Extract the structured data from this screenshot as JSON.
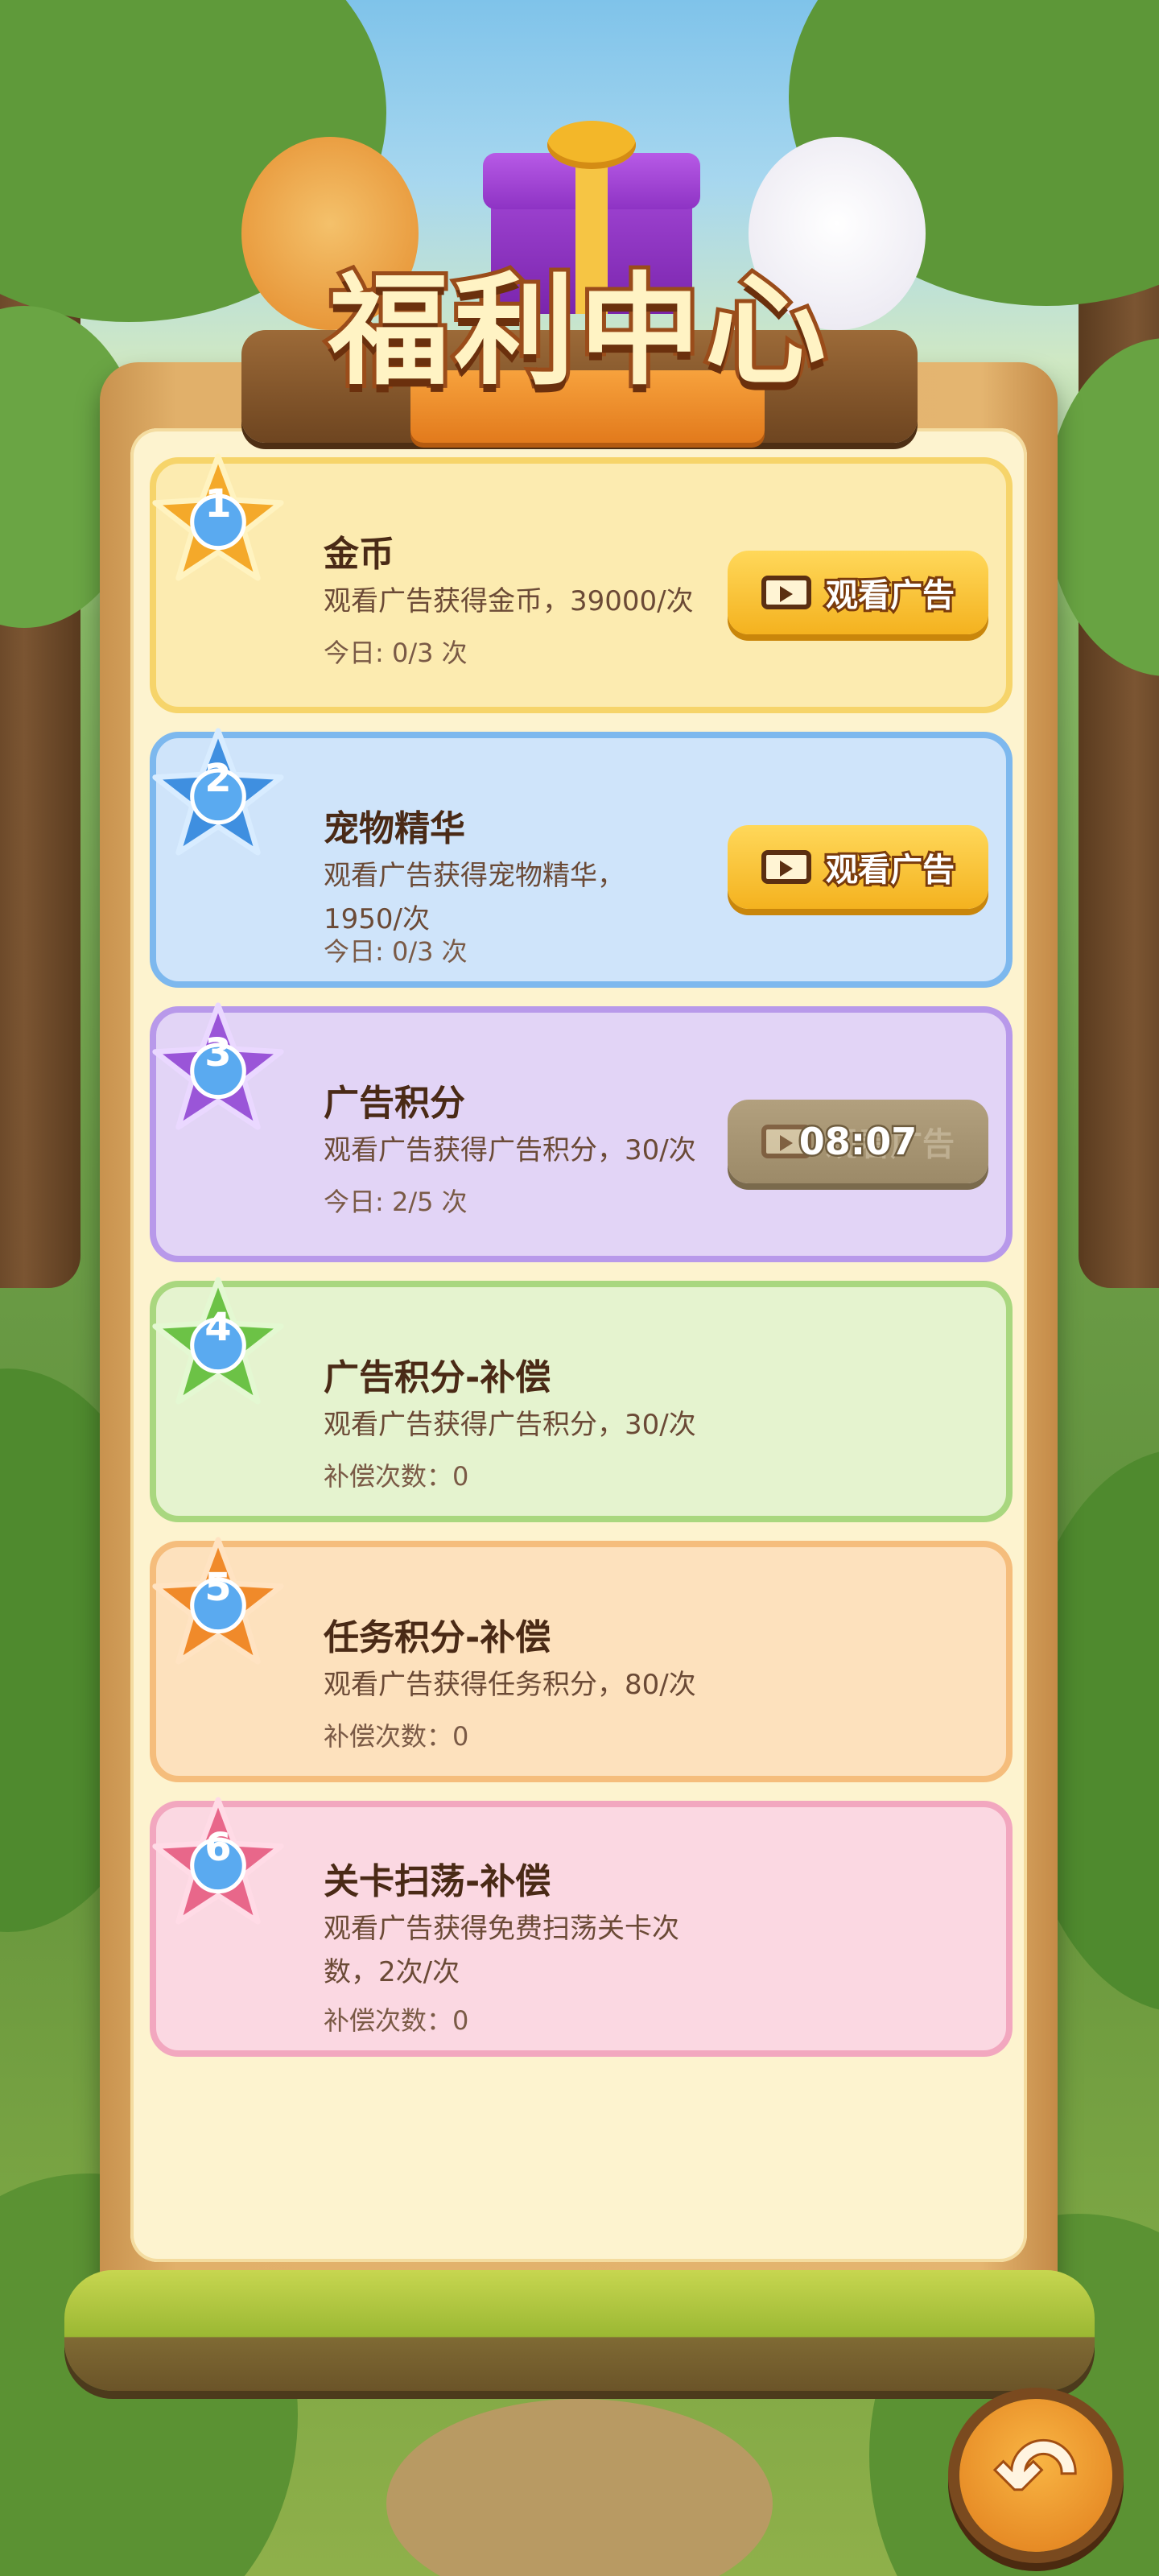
{
  "header": {
    "title": "福利中心"
  },
  "cards": [
    {
      "index": "1",
      "name": "金币",
      "desc": "观看广告获得金币，39000/次",
      "count": "今日: 0/3 次",
      "button": "观看广告"
    },
    {
      "index": "2",
      "name": "宠物精华",
      "desc": "观看广告获得宠物精华，1950/次",
      "count": "今日: 0/3 次",
      "button": "观看广告"
    },
    {
      "index": "3",
      "name": "广告积分",
      "desc": "观看广告获得广告积分，30/次",
      "count": "今日: 2/5 次",
      "button": "观看广告",
      "cooldown": "08:07"
    },
    {
      "index": "4",
      "name": "广告积分-补偿",
      "desc": "观看广告获得广告积分，30/次",
      "count": "补偿次数：0"
    },
    {
      "index": "5",
      "name": "任务积分-补偿",
      "desc": "观看广告获得任务积分，80/次",
      "count": "补偿次数：0"
    },
    {
      "index": "6",
      "name": "关卡扫荡-补偿",
      "desc": "观看广告获得免费扫荡关卡次数，2次/次",
      "count": "补偿次数：0"
    }
  ],
  "colors": {
    "card1": "#fcebb0",
    "card2": "#cfe4fa",
    "card3": "#e2d4f6",
    "card4": "#e5f3cf",
    "card5": "#fde1bd",
    "card6": "#fbd8e2",
    "star1": "#f4a92a",
    "star2": "#3f8fe0",
    "star3": "#9a55d8",
    "star4": "#6cc246",
    "star5": "#f08a2a",
    "star6": "#e8678a"
  },
  "icons": {
    "video": "video-icon",
    "back": "back-arrow-icon"
  }
}
